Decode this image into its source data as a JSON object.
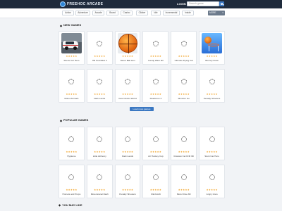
{
  "header": {
    "logo_text": "FREEHOC ARCADE",
    "login_label": "LOGIN",
    "search_placeholder": "Search game"
  },
  "categories": [
    "Action",
    "Adventure",
    "Arcade",
    "Board",
    "Casino",
    "Clicker",
    "Idle",
    "Incremental",
    "Inside"
  ],
  "more_label": "MORE",
  "sections": {
    "new_title": "NEW GAMES",
    "popular_title": "POPULAR GAMES",
    "maylike_title": "YOU MAY LIKE"
  },
  "new_games": [
    {
      "name": "Sirens Car Hero",
      "thumb": "car",
      "stars": "★★★★★"
    },
    {
      "name": "Hill Sunn/Rat 2",
      "thumb": "spinner",
      "stars": "★★★★★"
    },
    {
      "name": "Street Ball Jam",
      "thumb": "basketball",
      "stars": "★★★★★"
    },
    {
      "name": "Candy Wars 3D",
      "thumb": "spinner",
      "stars": "★★★★★"
    },
    {
      "name": "Ultimate Flying Car",
      "thumb": "spinner",
      "stars": "★★★★★"
    },
    {
      "name": "Bouncy Dunk",
      "thumb": "hoop",
      "stars": "★★★★★"
    },
    {
      "name": "Robot Animals",
      "thumb": "spinner",
      "stars": "★★★★★"
    },
    {
      "name": "Dark Lands",
      "thumb": "spinner",
      "stars": "★★★★★"
    },
    {
      "name": "Fast Climbs World",
      "thumb": "spinner",
      "stars": "★★★★★"
    },
    {
      "name": "Deadzone 3",
      "thumb": "spinner",
      "stars": "★★★★★"
    },
    {
      "name": "Monster Go",
      "thumb": "spinner",
      "stars": "★★★★★"
    },
    {
      "name": "Penalty Shooters",
      "thumb": "spinner",
      "stars": "★★★★★"
    }
  ],
  "load_more_label": "Load more games",
  "popular_games": [
    {
      "name": "Hypleme",
      "thumb": "spinner",
      "stars": "★★★★★"
    },
    {
      "name": "Little Alchemy",
      "thumb": "spinner",
      "stars": "★★★★★"
    },
    {
      "name": "Dark Lands",
      "thumb": "spinner",
      "stars": "★★★★★"
    },
    {
      "name": "Air Hockey Cup",
      "thumb": "spinner",
      "stars": "★★★★★"
    },
    {
      "name": "Russian Car Drift 3D",
      "thumb": "spinner",
      "stars": "★★★★★"
    },
    {
      "name": "Stunt Car Hero",
      "thumb": "spinner",
      "stars": "★★★★★"
    },
    {
      "name": "Hornets and Props",
      "thumb": "spinner",
      "stars": "★★★★★"
    },
    {
      "name": "Dimensional Dash",
      "thumb": "spinner",
      "stars": "★★★★★"
    },
    {
      "name": "Penalty Shooters",
      "thumb": "spinner",
      "stars": "★★★★★"
    },
    {
      "name": "Climbcraft",
      "thumb": "spinner",
      "stars": "★★★★★"
    },
    {
      "name": "Moto Drive 3D",
      "thumb": "spinner",
      "stars": "★★★★★"
    },
    {
      "name": "Angry Gran",
      "thumb": "spinner",
      "stars": "★★★★★"
    }
  ],
  "colors": {
    "accent": "#3b78c2",
    "header": "#1f2b3c",
    "stars": "#f0a020"
  }
}
